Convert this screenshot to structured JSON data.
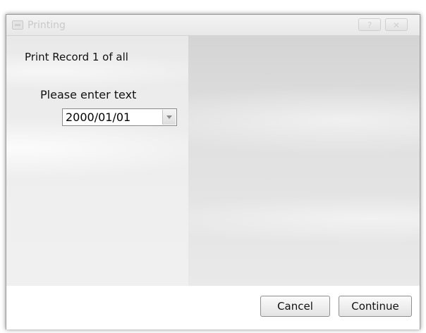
{
  "window": {
    "title": "Printing",
    "help_label": "?",
    "close_label": "✕"
  },
  "dialog": {
    "record_text": "Print Record 1 of all",
    "prompt_label": "Please enter text",
    "input": {
      "value": "2000/01/01"
    }
  },
  "buttons": {
    "cancel_label": "Cancel",
    "continue_label": "Continue"
  },
  "icons": {
    "title_icon": "printer-window-icon",
    "dropdown_icon": "chevron-down-icon"
  }
}
